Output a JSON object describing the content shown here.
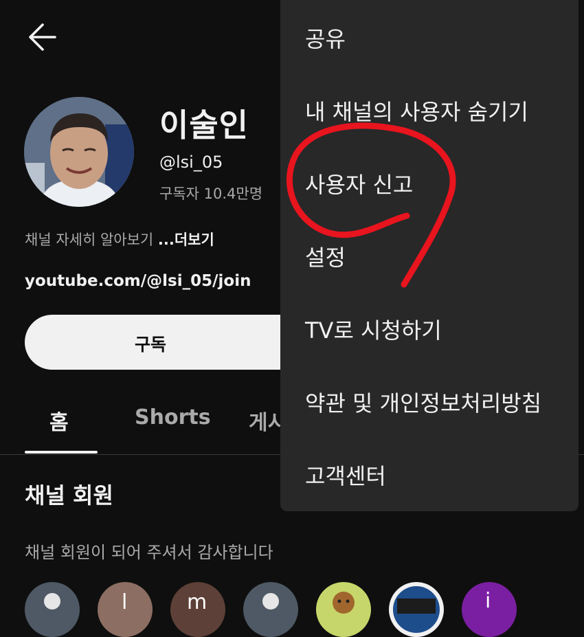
{
  "header": {
    "back_icon": "arrow-left-icon"
  },
  "channel": {
    "name": "이술인",
    "handle": "@lsi_05",
    "subscribers": "구독자 10.4만명",
    "about": "채널 자세히 알아보기 ",
    "about_more": "...더보기",
    "link": "youtube.com/@lsi_05/join"
  },
  "subscribe_label": "구독",
  "tabs": [
    {
      "label": "홈"
    },
    {
      "label": "Shorts"
    },
    {
      "label": "게시"
    }
  ],
  "members": {
    "title": "채널 회원",
    "description": "채널 회원이 되어 주셔서 감사합니다",
    "avatar_letters": [
      "l",
      "m",
      "i"
    ]
  },
  "menu": {
    "items": [
      {
        "label": "공유"
      },
      {
        "label": "내 채널의 사용자 숨기기"
      },
      {
        "label": "사용자 신고"
      },
      {
        "label": "설정"
      },
      {
        "label": "TV로 시청하기"
      },
      {
        "label": "약관 및 개인정보처리방침"
      },
      {
        "label": "고객센터"
      }
    ]
  },
  "colors": {
    "background": "#0f0f0f",
    "menu_background": "#282828",
    "annotation": "#e8141e"
  }
}
